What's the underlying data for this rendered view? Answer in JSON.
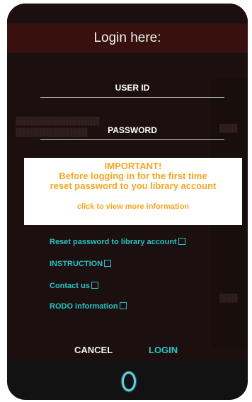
{
  "login": {
    "title": "Login here:",
    "user_id_placeholder": "USER ID",
    "password_placeholder": "PASSWORD"
  },
  "notice": {
    "heading": "IMPORTANT!",
    "line1": "Before logging in for the first time",
    "line2": "reset password to you library account",
    "more_link": "click to view more information"
  },
  "links": {
    "reset_password": "Reset password to library account",
    "instruction": "INSTRUCTION",
    "contact": "Contact us",
    "rodo": "RODO information"
  },
  "buttons": {
    "cancel": "CANCEL",
    "login": "LOGIN"
  },
  "colors": {
    "accent": "#27c4c8",
    "notice_text": "#f5a623",
    "modal_bg": "#121212"
  }
}
